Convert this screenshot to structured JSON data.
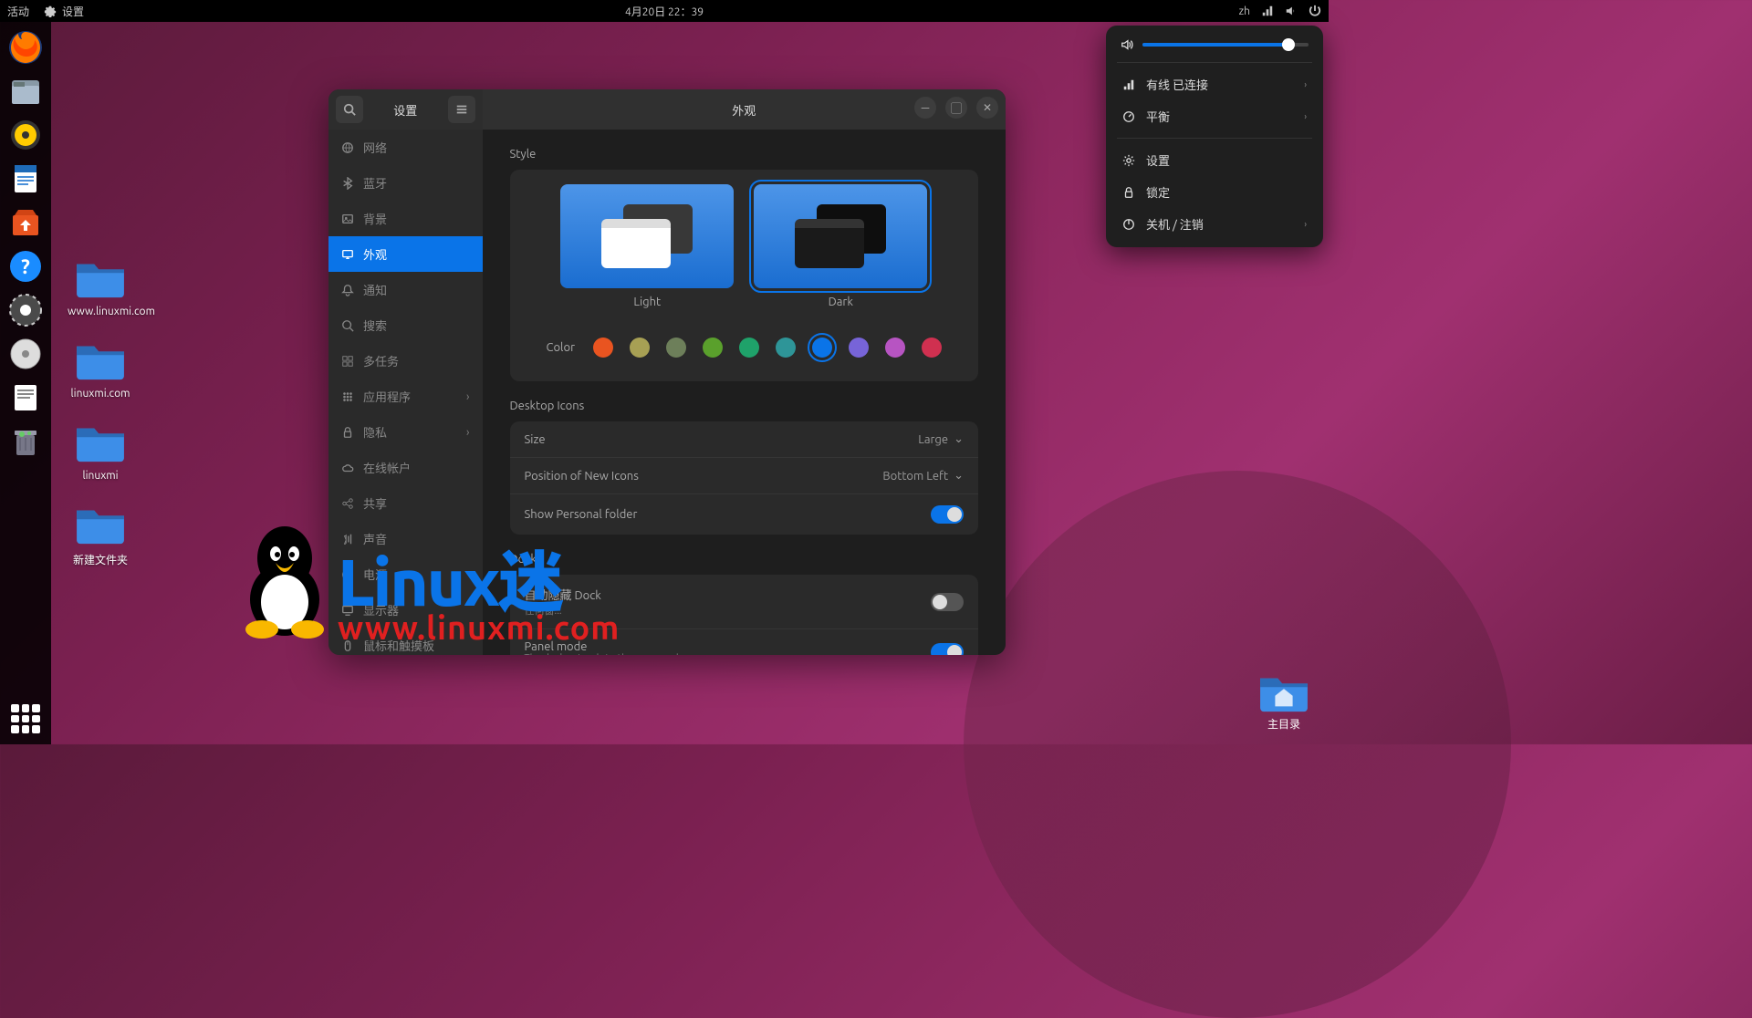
{
  "topbar": {
    "activities": "活动",
    "app_indicator": "设置",
    "datetime": "4月20日  22：39",
    "ime": "zh"
  },
  "dock": {
    "items": [
      "firefox",
      "files",
      "rhythmbox",
      "writer",
      "software",
      "help",
      "settings",
      "disc",
      "text-editor",
      "trash"
    ]
  },
  "desktop_icons": [
    {
      "label": "www.linuxmi.com"
    },
    {
      "label": "linuxmi.com"
    },
    {
      "label": "linuxmi"
    },
    {
      "label": "新建文件夹"
    }
  ],
  "home_icon": {
    "label": "主目录"
  },
  "settings_window": {
    "sidebar_title": "设置",
    "sidebar": [
      {
        "label": "网络",
        "icon": "globe"
      },
      {
        "label": "蓝牙",
        "icon": "bluetooth"
      },
      {
        "label": "背景",
        "icon": "image"
      },
      {
        "label": "外观",
        "icon": "display",
        "active": true
      },
      {
        "label": "通知",
        "icon": "bell"
      },
      {
        "label": "搜索",
        "icon": "search"
      },
      {
        "label": "多任务",
        "icon": "multitask"
      },
      {
        "label": "应用程序",
        "icon": "apps",
        "chev": true
      },
      {
        "label": "隐私",
        "icon": "lock",
        "chev": true
      },
      {
        "label": "在线帐户",
        "icon": "cloud"
      },
      {
        "label": "共享",
        "icon": "share"
      },
      {
        "label": "声音",
        "icon": "sound"
      },
      {
        "label": "电源",
        "icon": "power"
      },
      {
        "label": "显示器",
        "icon": "monitor"
      },
      {
        "label": "鼠标和触摸板",
        "icon": "mouse"
      }
    ],
    "main_title": "外观",
    "style": {
      "heading": "Style",
      "light_label": "Light",
      "dark_label": "Dark",
      "selected": "dark",
      "color_label": "Color",
      "colors": [
        "#e95420",
        "#a7a054",
        "#6d7f5a",
        "#5aa02c",
        "#1fa26a",
        "#2e9598",
        "#0a74e8",
        "#7764d8",
        "#b754c2",
        "#d03050"
      ],
      "selected_color_index": 6
    },
    "desktop_icons": {
      "heading": "Desktop Icons",
      "size_label": "Size",
      "size_value": "Large",
      "position_label": "Position of New Icons",
      "position_value": "Bottom Left",
      "personal_label": "Show Personal folder",
      "personal_on": true
    },
    "dock_section": {
      "heading": "Dock",
      "autohide_label": "自动隐藏 Dock",
      "autohide_sub": "任何窗...",
      "autohide_on": false,
      "panel_label": "Panel mode",
      "panel_sub": "The dock extends to the screen edge.",
      "panel_on": true
    }
  },
  "sys_menu": {
    "volume_percent": 88,
    "items": [
      {
        "label": "有线 已连接",
        "icon": "network",
        "chev": true
      },
      {
        "label": "平衡",
        "icon": "gauge",
        "chev": true
      },
      {
        "sep": true
      },
      {
        "label": "设置",
        "icon": "gear"
      },
      {
        "label": "锁定",
        "icon": "lock"
      },
      {
        "label": "关机 / 注销",
        "icon": "power",
        "chev": true
      }
    ]
  },
  "watermark": {
    "text": "Linux迷",
    "url": "www.linuxmi.com"
  }
}
